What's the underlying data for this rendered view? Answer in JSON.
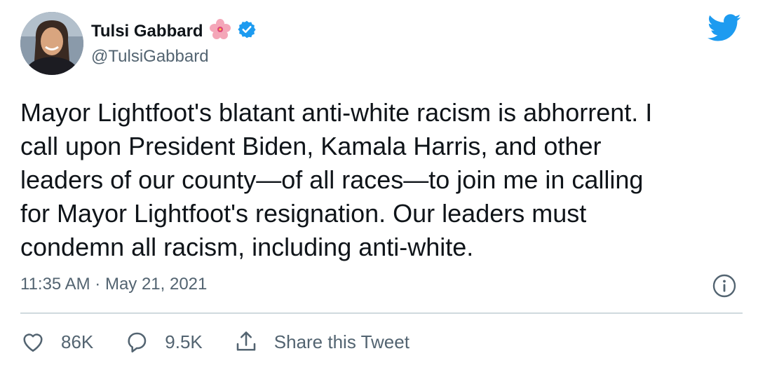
{
  "author": {
    "display_name": "Tulsi Gabbard",
    "handle": "@TulsiGabbard",
    "emoji": "hibiscus-flower-icon",
    "verified": true
  },
  "tweet": {
    "text": "Mayor Lightfoot's blatant anti-white racism is abhorrent. I\ncall upon President Biden, Kamala Harris, and other\nleaders of our county—of all races—to join me in calling\nfor Mayor Lightfoot's resignation. Our leaders must\ncondemn all racism, including anti-white.",
    "timestamp": "11:35 AM · May 21, 2021"
  },
  "actions": {
    "like_count": "86K",
    "reply_count": "9.5K",
    "share_label": "Share this Tweet"
  },
  "colors": {
    "brand": "#1d9bf0",
    "text": "#0f1419",
    "secondary": "#536471",
    "divider": "#cfd9de"
  }
}
